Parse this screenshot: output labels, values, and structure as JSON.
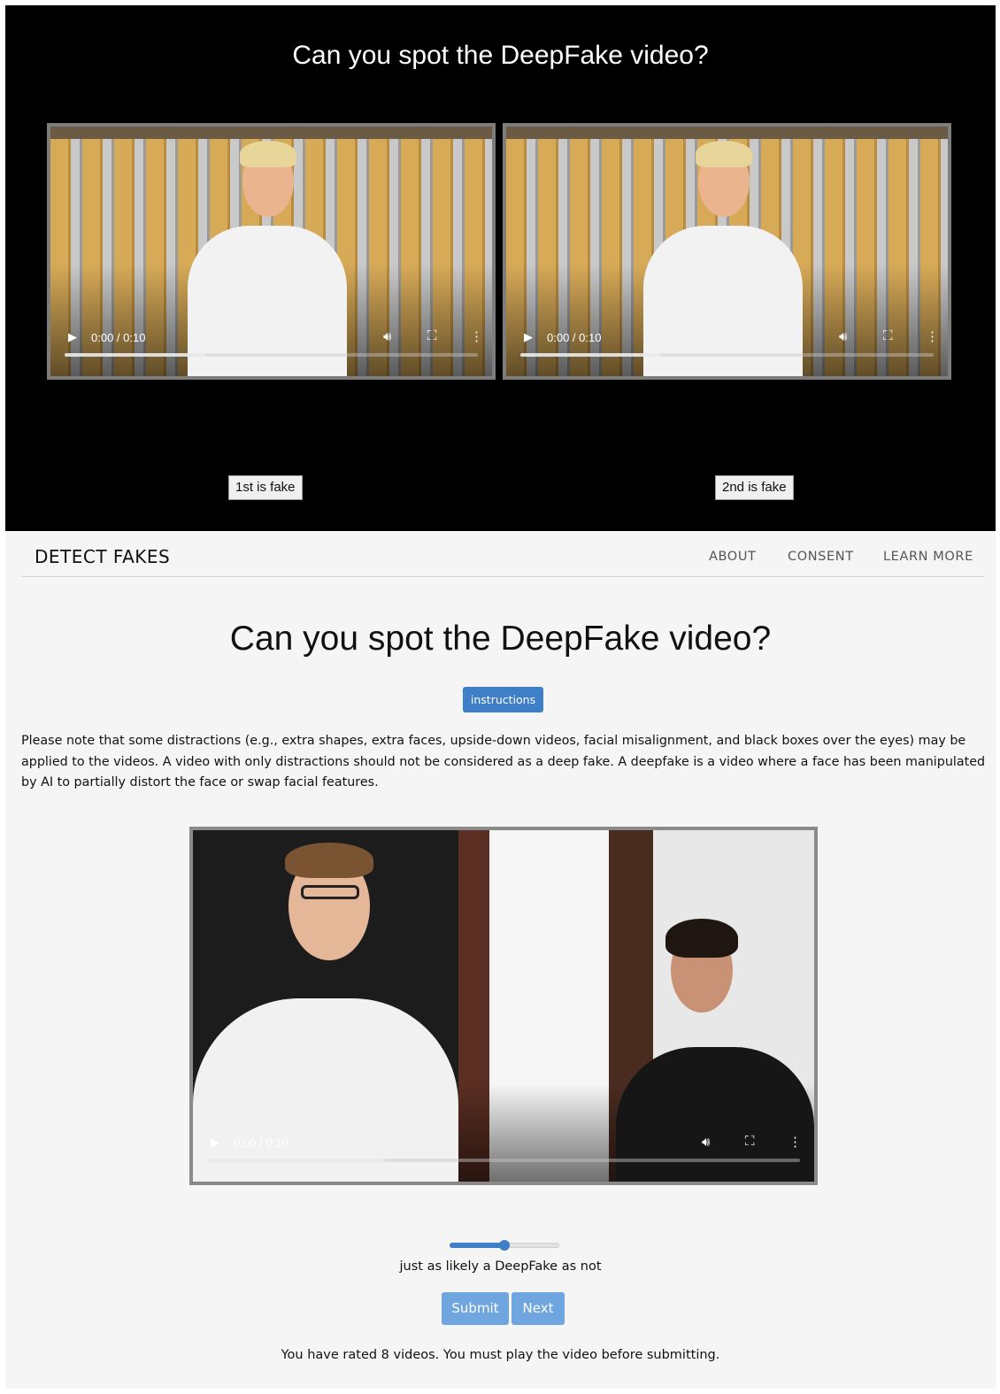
{
  "top_panel": {
    "title": "Can you spot the DeepFake video?",
    "videos": [
      {
        "time": "0:00 / 0:10",
        "progress": 0.34
      },
      {
        "time": "0:00 / 0:10",
        "progress": 0.34
      }
    ],
    "choice_1_label": "1st is fake",
    "choice_2_label": "2nd is fake"
  },
  "navbar": {
    "brand": "DETECT FAKES",
    "links": [
      "ABOUT",
      "CONSENT",
      "LEARN MORE"
    ]
  },
  "main": {
    "title": "Can you spot the DeepFake video?",
    "instructions_label": "instructions",
    "note": "Please note that some distractions (e.g., extra shapes, extra faces, upside-down videos, facial misalignment, and black boxes over the eyes) may be applied to the videos. A video with only distractions should not be considered as a deep fake. A deepfake is a video where a face has been manipulated by AI to partially distort the face or swap facial features.",
    "video": {
      "time": "0:00 / 0:10",
      "progress": 0.3
    },
    "slider": {
      "value": 0.5,
      "label": "just as likely a DeepFake as not"
    },
    "submit_label": "Submit",
    "next_label": "Next",
    "status": "You have rated 8 videos. You must play the video before submitting."
  },
  "colors": {
    "accent": "#3f7fc8",
    "button_disabled": "#6fa6df",
    "top_background": "#000000",
    "page_background": "#f5f5f5"
  },
  "icons": {
    "play": "play-icon",
    "volume": "volume-icon",
    "fullscreen": "fullscreen-icon",
    "more": "more-options-icon"
  }
}
